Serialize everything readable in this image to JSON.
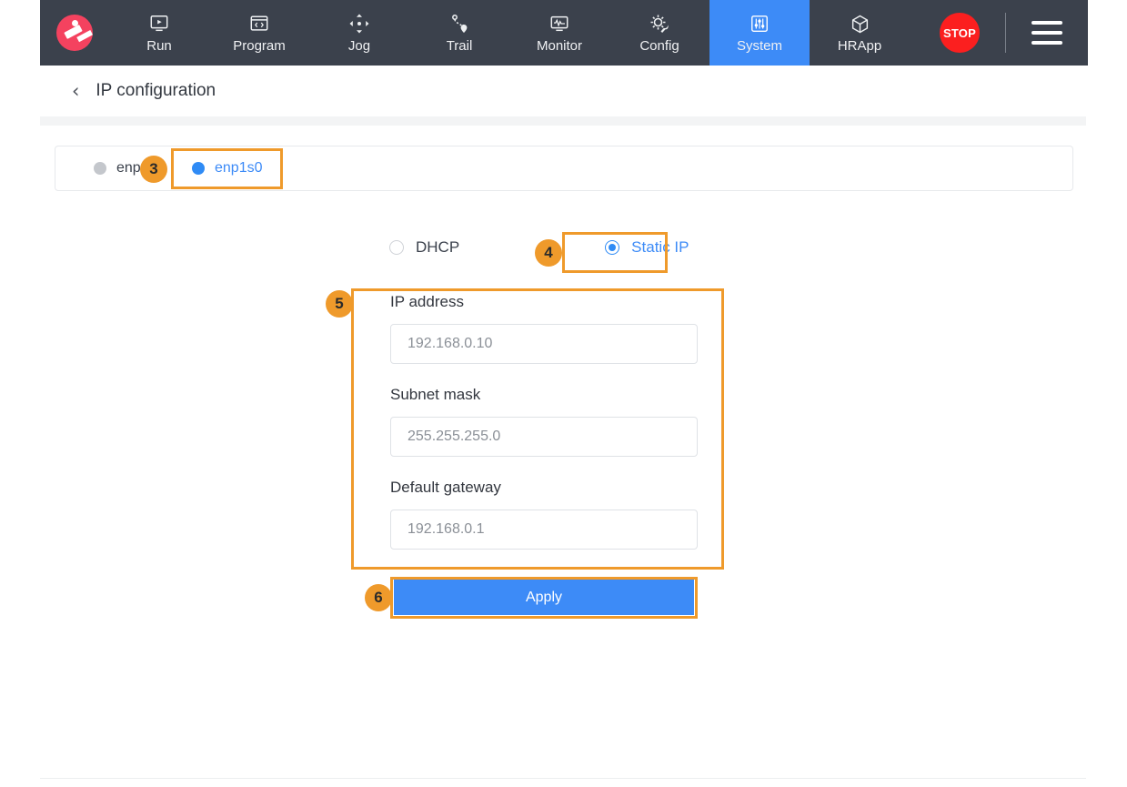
{
  "toolbar": {
    "logo_name": "robot-logo-icon",
    "items": [
      {
        "label": "Run",
        "icon": "run-monitor-icon",
        "active": false
      },
      {
        "label": "Program",
        "icon": "code-window-icon",
        "active": false
      },
      {
        "label": "Jog",
        "icon": "move-arrows-icon",
        "active": false
      },
      {
        "label": "Trail",
        "icon": "path-pin-icon",
        "active": false
      },
      {
        "label": "Monitor",
        "icon": "waveform-screen-icon",
        "active": false
      },
      {
        "label": "Config",
        "icon": "gear-wrench-icon",
        "active": false
      },
      {
        "label": "System",
        "icon": "sliders-panel-icon",
        "active": true
      },
      {
        "label": "HRApp",
        "icon": "cube-icon",
        "active": false
      }
    ],
    "stop_label": "STOP",
    "menu_icon": "hamburger-menu-icon",
    "active_color": "#3d8bf7",
    "background_color": "#3b414c",
    "stop_color": "#fb1f1f"
  },
  "header": {
    "back_icon": "chevron-left-icon",
    "title": "IP configuration"
  },
  "tabs": [
    {
      "label": "enp3s0",
      "status_dot": "status-dot-inactive",
      "active": false
    },
    {
      "label": "enp1s0",
      "status_dot": "status-dot-active",
      "active": true
    }
  ],
  "mode": {
    "options": [
      {
        "label": "DHCP",
        "selected": false
      },
      {
        "label": "Static IP",
        "selected": true
      }
    ]
  },
  "form": {
    "fields": [
      {
        "label": "IP address",
        "value": "192.168.0.10",
        "placeholder": "192.168.0.10"
      },
      {
        "label": "Subnet mask",
        "value": "255.255.255.0",
        "placeholder": "255.255.255.0"
      },
      {
        "label": "Default gateway",
        "value": "192.168.0.1",
        "placeholder": "192.168.0.1"
      }
    ],
    "apply_label": "Apply"
  },
  "annotations": {
    "color": "#ef9a2b",
    "badges": [
      {
        "number": "3",
        "target": "tab-enp1s0"
      },
      {
        "number": "4",
        "target": "radio-static-ip"
      },
      {
        "number": "5",
        "target": "ip-form-fields"
      },
      {
        "number": "6",
        "target": "apply-button"
      }
    ]
  }
}
